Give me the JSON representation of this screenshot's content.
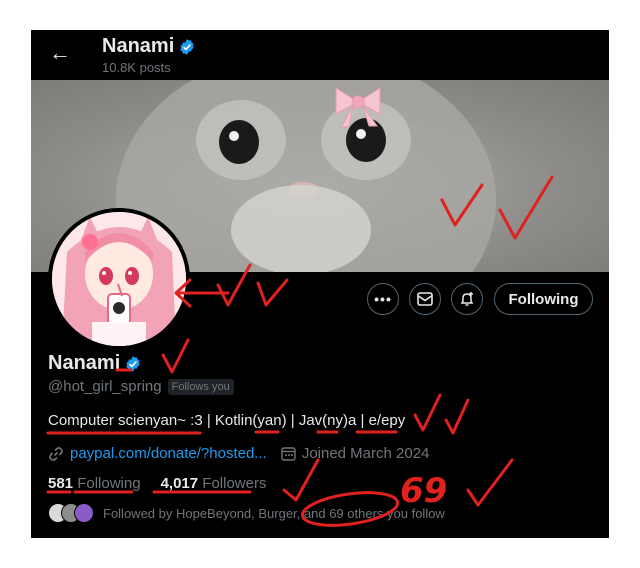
{
  "header": {
    "name": "Nanami",
    "posts": "10.8K posts"
  },
  "profile": {
    "name": "Nanami",
    "handle": "@hot_girl_spring",
    "follows_you": "Follows you",
    "bio": "Computer scienyan~ :3 | Kotlin(yan) | Jav(ny)a | e/epy",
    "link": "paypal.com/donate/?hosted...",
    "joined": "Joined March 2024",
    "following_count": "581",
    "following_label": "Following",
    "followers_count": "4,017",
    "followers_label": "Followers",
    "followed_by": "Followed by HopeBeyond, Burger, and 69 others you follow"
  },
  "actions": {
    "more_icon": "more-icon",
    "message_icon": "mail-icon",
    "notify_icon": "bell-plus-icon",
    "follow_label": "Following"
  },
  "annotations": {
    "handwritten_number": "69"
  },
  "colors": {
    "background": "#000000",
    "accent": "#1d9bf0",
    "text": "#e7e9ea",
    "muted": "#71767b",
    "annotation": "#e0211f"
  }
}
